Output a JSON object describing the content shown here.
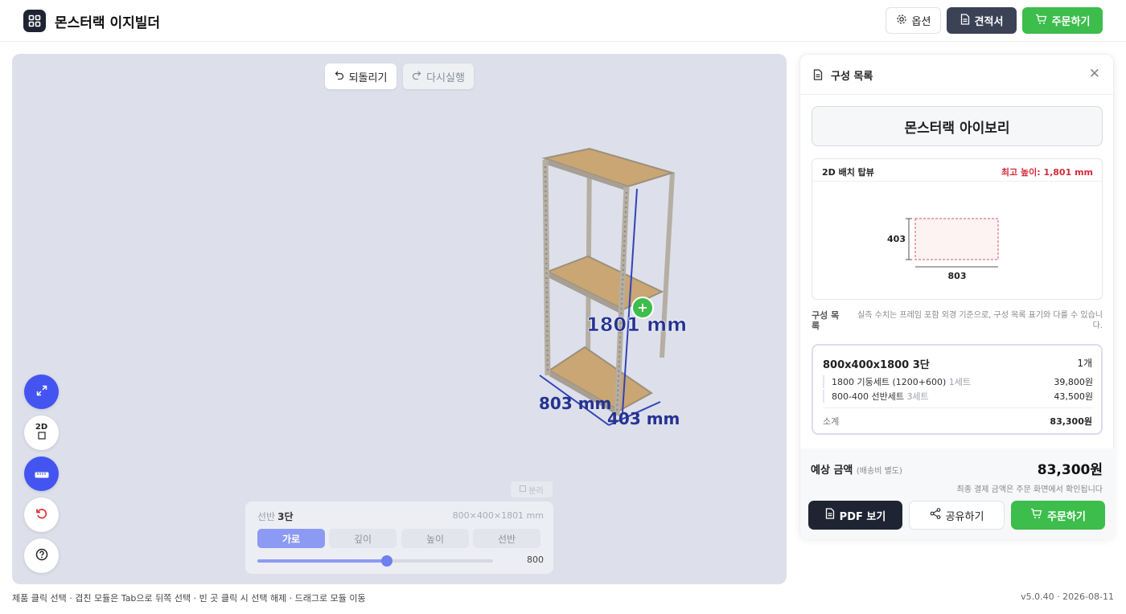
{
  "app": {
    "title": "몬스터랙 이지빌더"
  },
  "header": {
    "options_label": "옵션",
    "quote_label": "견적서",
    "order_label": "주문하기"
  },
  "canvas": {
    "undo_label": "되돌리기",
    "redo_label": "다시실행",
    "dim_height": "1801 mm",
    "dim_width": "803 mm",
    "dim_depth": "403 mm",
    "fab_2d_label": "2D",
    "split_label": "분리"
  },
  "control": {
    "shelf_label": "선반",
    "shelf_value": "3단",
    "dims_text": "800×400×1801 mm",
    "tabs": [
      "가로",
      "깊이",
      "높이",
      "선반"
    ],
    "active_tab": "가로",
    "slider_value": "800",
    "slider_fraction": 0.55
  },
  "footer": {
    "hint": "제품 클릭 선택 · 겹친 모듈은 Tab으로 뒤쪽 선택 · 빈 곳 클릭 시 선택 해제 · 드래그로 모듈 이동",
    "version": "v5.0.40 · 2026-08-11"
  },
  "panel": {
    "title": "구성 목록",
    "product_name": "몬스터랙 아이보리",
    "topview_title": "2D 배치 탑뷰",
    "max_height_label": "최고 높이: 1,801 mm",
    "topview_depth": "403",
    "topview_width": "803",
    "list_label": "구성 목록",
    "list_note": "실측 수치는 프레임 포함 외경 기준으로, 구성 목록 표기와 다를 수 있습니다.",
    "item": {
      "title": "800x400x1800 3단",
      "qty": "1개",
      "lines": [
        {
          "name": "1800 기둥세트 (1200+600)",
          "count": "1세트",
          "price": "39,800원"
        },
        {
          "name": "800-400 선반세트",
          "count": "3세트",
          "price": "43,500원"
        }
      ],
      "subtotal_label": "소계",
      "subtotal_value": "83,300원"
    },
    "estimate_label": "예상 금액",
    "estimate_sub": "(배송비 별도)",
    "estimate_value": "83,300원",
    "estimate_note": "최종 결제 금액은 주문 화면에서 확인됩니다",
    "pdf_label": "PDF 보기",
    "share_label": "공유하기",
    "order_label": "주문하기"
  },
  "colors": {
    "accent": "#4454f0",
    "order_green": "#3dbd4c",
    "dark": "#1f2433",
    "max_red": "#d42a3a",
    "canvas_bg": "#dde0ea",
    "shelf_wood": "#c9a673"
  }
}
